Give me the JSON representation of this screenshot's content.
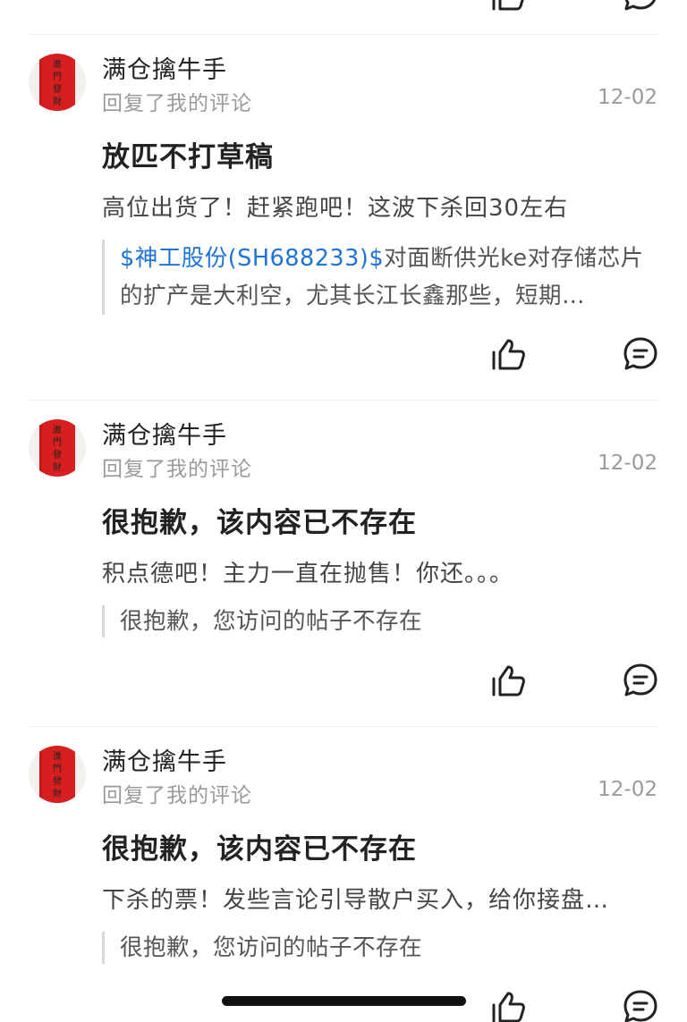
{
  "items": [
    {
      "username": "满仓擒牛手",
      "action": "回复了我的评论",
      "date": "12-02",
      "title": "放匹不打草稿",
      "reply": "高位出货了！赶紧跑吧！这波下杀回30左右",
      "quote_link": "$神工股份(SH688233)$",
      "quote_text": "对面断供光ke对存储芯片的扩产是大利空，尤其长江长鑫那些，短期…"
    },
    {
      "username": "满仓擒牛手",
      "action": "回复了我的评论",
      "date": "12-02",
      "title": "很抱歉，该内容已不存在",
      "reply": "积点德吧！主力一直在抛售！你还。。。",
      "quote_text": "很抱歉，您访问的帖子不存在"
    },
    {
      "username": "满仓擒牛手",
      "action": "回复了我的评论",
      "date": "12-02",
      "title": "很抱歉，该内容已不存在",
      "reply": "下杀的票！发些言论引导散户买入，给你接盘…",
      "quote_text": "很抱歉，您访问的帖子不存在"
    }
  ],
  "avatar_text": "進門發財",
  "icons": {
    "like": "thumbs-up-icon",
    "comment": "comment-bubble-icon"
  },
  "colors": {
    "link": "#1e73d8",
    "avatar_red": "#d81f1f",
    "meta_gray": "#9a9a9a"
  }
}
